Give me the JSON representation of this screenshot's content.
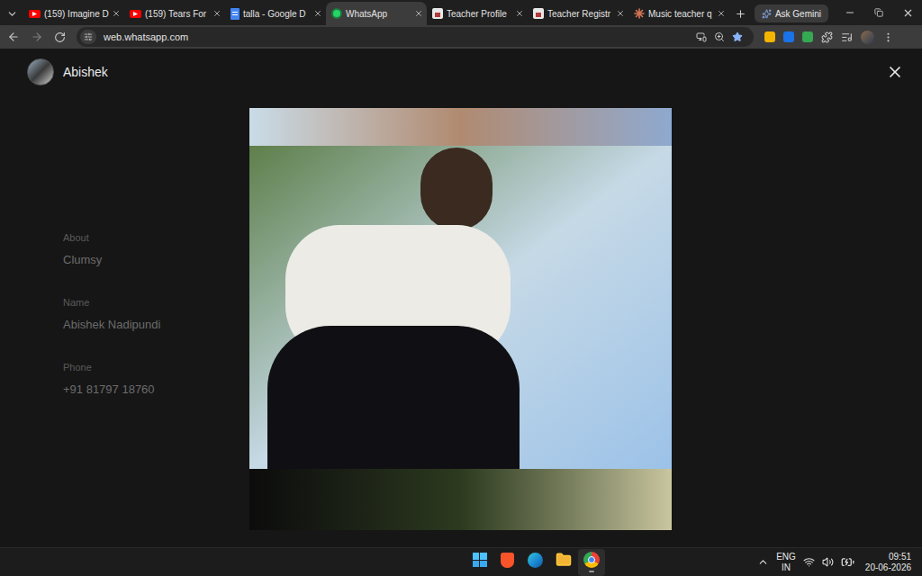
{
  "browser": {
    "tabs": [
      {
        "label": "(159) Imagine D",
        "kind": "youtube",
        "selected": false
      },
      {
        "label": "(159) Tears For",
        "kind": "youtube",
        "selected": false
      },
      {
        "label": "talla - Google D",
        "kind": "docs",
        "selected": false
      },
      {
        "label": "WhatsApp",
        "kind": "whatsapp",
        "selected": true
      },
      {
        "label": "Teacher Profile",
        "kind": "page",
        "selected": false
      },
      {
        "label": "Teacher Registr",
        "kind": "page",
        "selected": false
      },
      {
        "label": "Music teacher q",
        "kind": "claude",
        "selected": false
      }
    ],
    "address": "web.whatsapp.com",
    "bookmarked": true,
    "gemini_button": "Ask Gemini"
  },
  "viewer": {
    "contact_name": "Abishek"
  },
  "background_fields": [
    {
      "label": "About",
      "value": "Clumsy"
    },
    {
      "label": "Name",
      "value": "Abishek Nadipundi"
    },
    {
      "label": "Phone",
      "value": "+91 81797 18760"
    }
  ],
  "taskbar": {
    "apps": [
      {
        "kind": "start",
        "selected": false
      },
      {
        "kind": "brave",
        "selected": false
      },
      {
        "kind": "edge",
        "selected": false
      },
      {
        "kind": "explorer",
        "selected": false
      },
      {
        "kind": "chrome",
        "selected": true
      }
    ],
    "language": "ENG",
    "region": "IN",
    "time": "09:51",
    "date": "20-06-2026"
  }
}
